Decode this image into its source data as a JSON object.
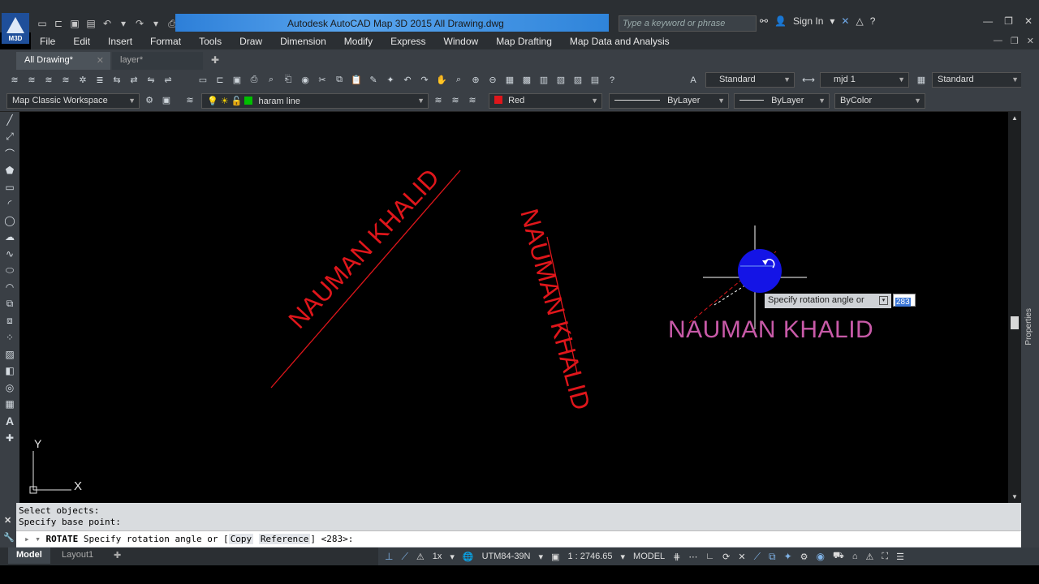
{
  "app": {
    "title": "Autodesk AutoCAD Map 3D 2015    All Drawing.dwg",
    "logo_text": "M3D",
    "search_placeholder": "Type a keyword or phrase",
    "sign_in": "Sign In"
  },
  "menu": [
    "File",
    "Edit",
    "Insert",
    "Format",
    "Tools",
    "Draw",
    "Dimension",
    "Modify",
    "Express",
    "Window",
    "Map Drafting",
    "Map Data and Analysis"
  ],
  "tabs": [
    {
      "label": "All Drawing*",
      "active": true
    },
    {
      "label": "layer*",
      "active": false
    }
  ],
  "toolbar": {
    "text_style": "Standard",
    "dim_style": "mjd 1",
    "table_style": "Standard",
    "workspace": "Map Classic Workspace",
    "layer": "haram line",
    "color": "Red",
    "linetype": "ByLayer",
    "lineweight": "ByLayer",
    "plotstyle": "ByColor"
  },
  "colors": {
    "accent": "#2f84da",
    "drawing_red": "#e0161b",
    "selection_magenta": "#c85aa8",
    "grip_blue": "#1414e6",
    "layer_swatch": "#00c000"
  },
  "canvas": {
    "text_1": "NAUMAN KHALID",
    "text_2": "NAUMAN KHALID",
    "text_3": "NAUMAN KHALID",
    "ucs_x": "X",
    "ucs_y": "Y",
    "tooltip": "Specify rotation angle or",
    "angle_value": "283"
  },
  "command": {
    "history": [
      "Select objects:",
      "Specify base point:"
    ],
    "cmd_name": "ROTATE",
    "prompt": "Specify rotation angle or [",
    "option_copy": "Copy",
    "option_reference": "Reference",
    "prompt_end": "] <283>:"
  },
  "status": {
    "model_tab": "Model",
    "layout_tab": "Layout1",
    "scale": "1x",
    "coord_system": "UTM84-39N",
    "viewport_scale": "1 : 2746.65",
    "space": "MODEL",
    "properties_label": "Properties"
  }
}
